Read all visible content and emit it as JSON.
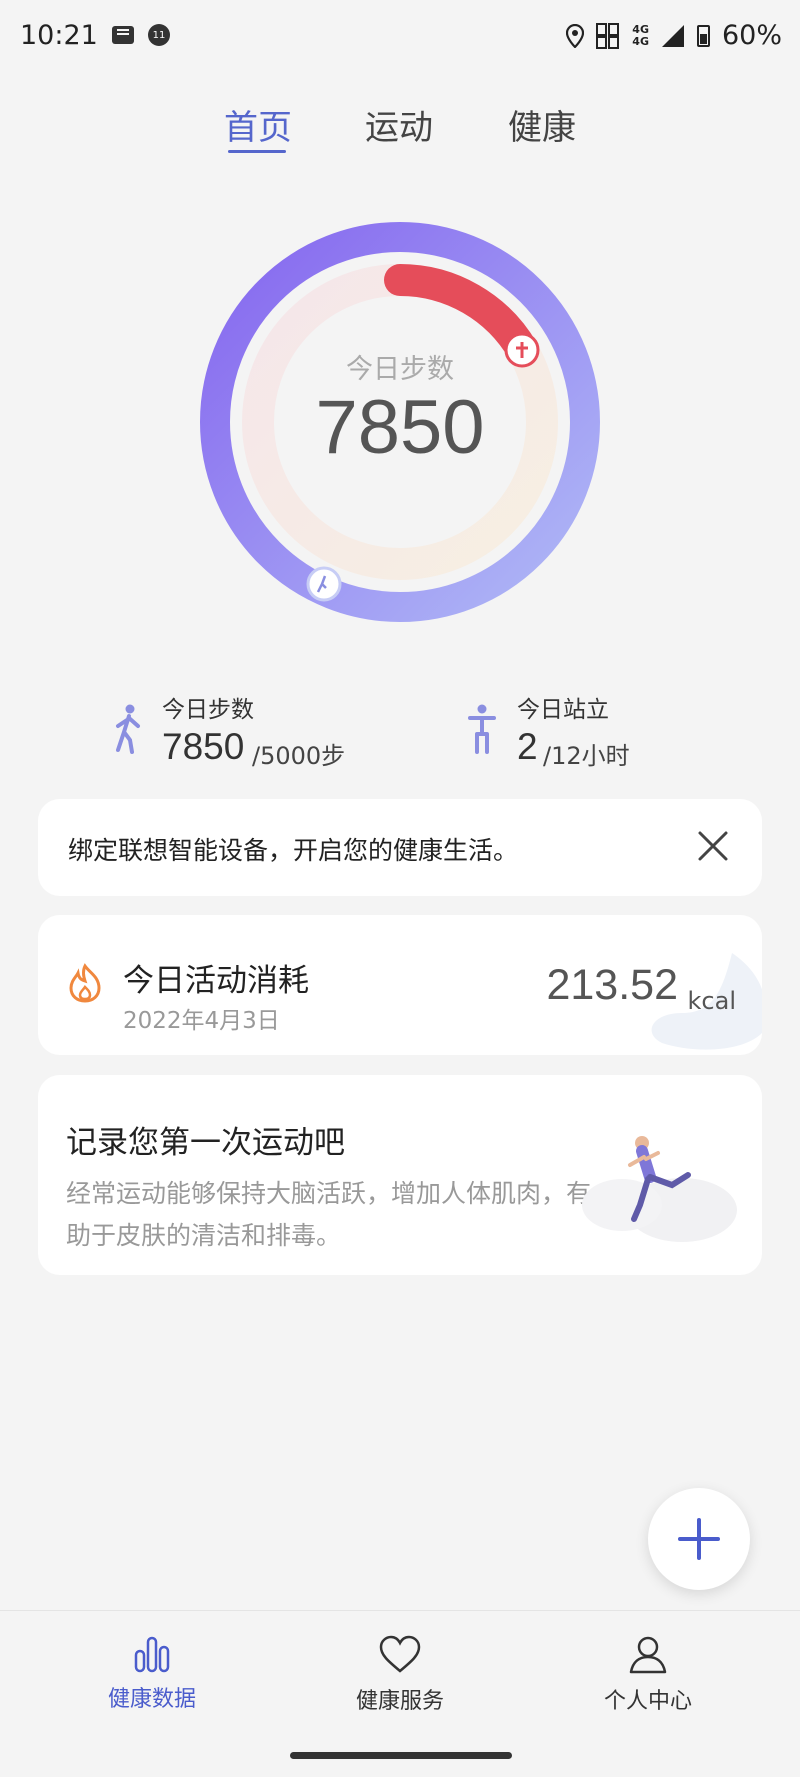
{
  "status_bar": {
    "time": "10:21",
    "notification_badge": "11",
    "network": "4G",
    "battery": "60%"
  },
  "tabs": [
    {
      "label": "首页",
      "active": true
    },
    {
      "label": "运动",
      "active": false
    },
    {
      "label": "健康",
      "active": false
    }
  ],
  "ring": {
    "label": "今日步数",
    "value": "7850",
    "steps_progress": 1.0,
    "stand_progress": 0.1667
  },
  "stats": {
    "steps": {
      "title": "今日步数",
      "value": "7850",
      "goal": "/5000步",
      "icon": "walking-person-icon"
    },
    "stand": {
      "title": "今日站立",
      "value": "2",
      "goal": "/12小时",
      "icon": "standing-person-icon"
    }
  },
  "bind_banner": {
    "text": "绑定联想智能设备，开启您的健康生活。",
    "close_icon": "close-icon"
  },
  "energy": {
    "title": "今日活动消耗",
    "date": "2022年4月3日",
    "value": "213.52",
    "unit": "kcal",
    "icon": "flame-icon"
  },
  "record": {
    "title": "记录您第一次运动吧",
    "description": "经常运动能够保持大脑活跃，增加人体肌肉，有助于皮肤的清洁和排毒。"
  },
  "bottom_nav": [
    {
      "label": "健康数据",
      "icon": "bar-chart-icon",
      "active": true
    },
    {
      "label": "健康服务",
      "icon": "heart-icon",
      "active": false
    },
    {
      "label": "个人中心",
      "icon": "person-icon",
      "active": false
    }
  ],
  "colors": {
    "accent": "#5566cc",
    "ring_outer_start": "#8a6cf0",
    "ring_outer_end": "#aab2f5",
    "ring_inner_red": "#e54d5a",
    "flame": "#f0883e"
  }
}
